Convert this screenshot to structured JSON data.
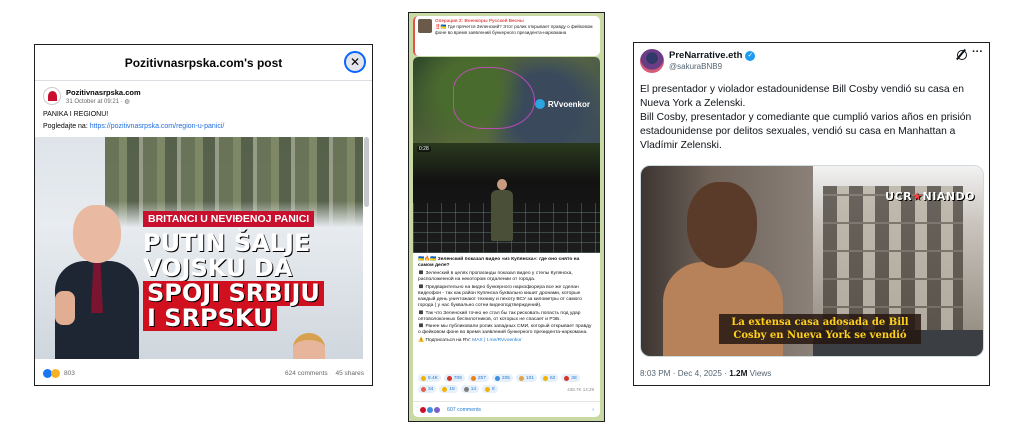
{
  "facebook": {
    "header_title": "Pozitivnasrpska.com's post",
    "close_icon": "close-icon",
    "author": "Pozitivnasrpska.com",
    "date": "31 October at 09:21 · ",
    "line1": "PANIKA I REGIONU!",
    "line2_prefix": "Pogledajte na: ",
    "link": "https://pozitivnasrpska.com/region-u-panici/",
    "banner": "BRITANCI U NEVIĐENOJ PANICI",
    "headline_l1": "PUTIN ŠALJE",
    "headline_l2": "VOJSKU DA",
    "headline_l3": "SPOJI SRBIJU",
    "headline_l4": "I SRPSKU",
    "reactions_count": "803",
    "comments": "624 comments",
    "shares": "45 shares",
    "colors": {
      "link": "#216fdb",
      "banner": "#c8102e",
      "close_ring": "#0866ff"
    }
  },
  "telegram": {
    "reply_author": "Операция Z: Военкоры Русской Весны",
    "reply_text": "‼️🇺🇦 Где прячется Зеленский? Этот ролик открывает правду о фейковом фоне во время заявлений бункерного президента-наркомана",
    "watermark": "RVvoenkor",
    "video_time": "0:28",
    "title": "🇺🇦🔥🇺🇦 Зеленский показал видео «из Купянска»: где оно снято на самом деле?",
    "p1": "◼️ Зеленский в целях пропаганды показал видео у стелы Купянска, расположенной на некотором отдалении от города.",
    "p2": "◼️ Предварительно на видео бункерного наркофюрера все же сделан видеофон - так как район Купянска буквально кишит дронами, которые каждый день уничтожают технику и пехоту ВСУ за километры от самого города ( у нас буквально сотни видеоподтверждений).",
    "p3": "◼️ Так что Зеленский точно не стал бы так рисковать попасть под удар оптоволоконных беспилотников, от которых не спасает и РЭБ.",
    "p4": "◼️ Ранее мы публиковали ролик западных СМИ, который открывает правду о фейковом фоне во время заявлений бункерного президента-наркомана.",
    "subscribe_prefix": "⚠️ Подписаться на RV: ",
    "subscribe_links": "MAX | t.me/RVvoenkor",
    "reactions": [
      {
        "count": "8.4K",
        "color": "#f2b300"
      },
      {
        "count": "706",
        "color": "#d4352b"
      },
      {
        "count": "257",
        "color": "#f07f16"
      },
      {
        "count": "205",
        "color": "#3e8fe0"
      },
      {
        "count": "101",
        "color": "#e0a34a"
      },
      {
        "count": "62",
        "color": "#f2b300"
      },
      {
        "count": "38",
        "color": "#d4352b"
      },
      {
        "count": "34",
        "color": "#e85c4a"
      },
      {
        "count": "18",
        "color": "#f2b300"
      },
      {
        "count": "14",
        "color": "#7d7d7d"
      },
      {
        "count": "8",
        "color": "#f2b300"
      }
    ],
    "views": "436.7K  14:29",
    "comments": "607 comments",
    "comment_avatars": [
      "RV",
      "L",
      "AA"
    ]
  },
  "x": {
    "name": "PreNarrative.eth",
    "handle": "@sakuraBNB9",
    "text_p1": "El presentador y violador estadounidense Bill Cosby vendió su casa en Nueva York a Zelenski.",
    "text_p2": "Bill Cosby, presentador y comediante que cumplió varios años en prisión estadounidense por delitos sexuales, vendió su casa en Manhattan a Vladímir Zelenski.",
    "brand_a": "UCR",
    "brand_b": "NIANDO",
    "caption": "La extensa casa adosada de Bill Cosby en Nueva York se vendió",
    "meta_prefix": "8:03 PM · Dec 4, 2025 · ",
    "views_count": "1.2M",
    "views_label": " Views",
    "colors": {
      "verified": "#1d9bf0",
      "caption_text": "#ffd11a"
    }
  }
}
